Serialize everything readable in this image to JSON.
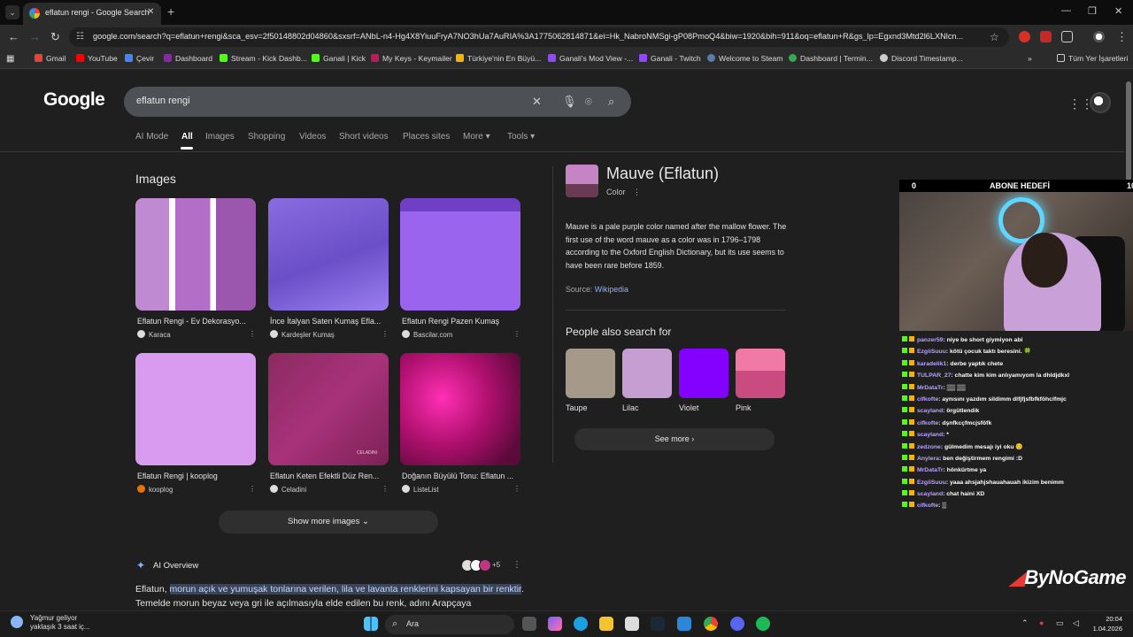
{
  "browser": {
    "tab_title": "eflatun rengi - Google Search",
    "url": "google.com/search?q=eflatun+rengi&sca_esv=2f50148802d04860&sxsrf=ANbL-n4-Hg4X8YiuuFryA7NO3hUa7AuRIA%3A1775062814871&ei=Hk_NabroNMSgi-gP08PmoQ4&biw=1920&bih=911&oq=eflatun+R&gs_lp=Egxnd3Mtd2l6LXNlcn...",
    "bookmarks": [
      "Gmail",
      "YouTube",
      "Çevir",
      "Dashboard",
      "Stream - Kick Dashb...",
      "Ganali | Kick",
      "My Keys - Keymailer",
      "Türkiye'nin En Büyü...",
      "Ganali's Mod View -...",
      "Ganali - Twitch",
      "Welcome to Steam",
      "Dashboard | Termin...",
      "Discord Timestamp..."
    ],
    "bookmarks_folder": "Tüm Yer İşaretleri"
  },
  "google": {
    "logo": "Google",
    "query": "eflatun rengi",
    "tabs": [
      "AI Mode",
      "All",
      "Images",
      "Shopping",
      "Videos",
      "Short videos",
      "Places sites",
      "More",
      "Tools"
    ],
    "images_heading": "Images",
    "images": [
      {
        "caption": "Eflatun Rengi - Ev Dekorasyo...",
        "source": "Karaca"
      },
      {
        "caption": "İnce İtalyan Saten Kumaş Efla...",
        "source": "Kardeşler Kumaş"
      },
      {
        "caption": "Eflatun Rengi Pazen Kumaş",
        "source": "Bascilar.com"
      },
      {
        "caption": "Eflatun Rengi | kooplog",
        "source": "kooplog"
      },
      {
        "caption": "Eflatun Keten Efektli Düz Ren...",
        "source": "Celadini"
      },
      {
        "caption": "Doğanın Büyülü Tonu: Eflatun ...",
        "source": "ListeList"
      }
    ],
    "watermark_celadini": "CELADINI",
    "show_more_images": "Show more images",
    "ai_overview_label": "AI Overview",
    "ai_overview_more": "+5",
    "ai_overview_lead": "Eflatun, ",
    "ai_overview_hl": "morun açık ve yumuşak tonlarına verilen, lila ve lavanta renklerini kapsayan bir renktir",
    "ai_overview_tail": ". Temelde morun beyaz veya gri ile açılmasıyla elde edilen bu renk, adını Arapçaya"
  },
  "knowledge_panel": {
    "title": "Mauve (Eflatun)",
    "subtitle": "Color",
    "description": "Mauve is a pale purple color named after the mallow flower. The first use of the word mauve as a color was in 1796–1798 according to the Oxford English Dictionary, but its use seems to have been rare before 1859.",
    "source_label": "Source: ",
    "source_link": "Wikipedia",
    "people_also_search_for": "People also search for",
    "related": [
      {
        "label": "Taupe",
        "color": "#a59a8a"
      },
      {
        "label": "Lilac",
        "color": "#c79ed2"
      },
      {
        "label": "Violet",
        "color": "#8400ff"
      },
      {
        "label": "Pink",
        "color": "#e2709a"
      }
    ],
    "see_more": "See more"
  },
  "stream_overlay": {
    "goal_left": "0",
    "goal_title": "ABONE HEDEFİ",
    "goal_right": "10",
    "chat": [
      {
        "user": "panzer59",
        "msg": ": niye be short giymiyon abi"
      },
      {
        "user": "EzgiiSuuu",
        "msg": ": kötü çocuk taktı beresini. 🍀"
      },
      {
        "user": "karadelik1",
        "msg": ": derbe yaptık chete"
      },
      {
        "user": "TULPAR_27",
        "msg": ": chatte kim kim anlıyamıyom la dhldjdkxl"
      },
      {
        "user": "MrDataTr",
        "msg": ": ▒▒ ▒▒"
      },
      {
        "user": "cifkofte",
        "msg": ": aynısını yazdım sildimm dlfjfjsfbfkföhclfmjc"
      },
      {
        "user": "scayland",
        "msg": ": örgütlendik"
      },
      {
        "user": "cifkofte",
        "msg": ": dşnfkcçfmcjsföfk"
      },
      {
        "user": "scayland",
        "msg": ": *"
      },
      {
        "user": "zedzone",
        "msg": ": gülmedim mesajı iyi oku 😊"
      },
      {
        "user": "Anylera",
        "msg": ": ben değiştirmem rengimi :D"
      },
      {
        "user": "MrDataTr",
        "msg": ": hönkürtme ya"
      },
      {
        "user": "EzgiiSuuu",
        "msg": ": yaaa ahsjahjshauahauah ikizim benimm"
      },
      {
        "user": "scayland",
        "msg": ": chat haini XD"
      },
      {
        "user": "cifkofte",
        "msg": ": ▒"
      }
    ],
    "brand": "ByNoGame"
  },
  "taskbar": {
    "weather_title": "Yağmur geliyor",
    "weather_sub": "yaklaşık 3 saat iç...",
    "search_label": "Ara",
    "time": "20:04",
    "date": "1.04.2026"
  }
}
